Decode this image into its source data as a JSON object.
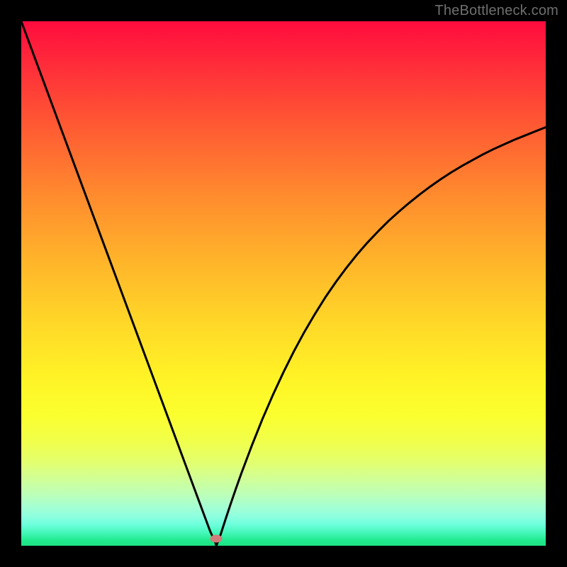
{
  "watermark": "TheBottleneck.com",
  "colors": {
    "frame": "#000000",
    "marker": "#cf7d7a",
    "curve": "#000000"
  },
  "chart_data": {
    "type": "line",
    "title": "",
    "xlabel": "",
    "ylabel": "",
    "xlim": [
      0,
      100
    ],
    "ylim": [
      0,
      100
    ],
    "grid": false,
    "legend": false,
    "annotations": [
      {
        "type": "marker",
        "x": 37.2,
        "y": 1.3,
        "shape": "ellipse",
        "color": "#cf7d7a"
      }
    ],
    "x": [
      0,
      2,
      4,
      6,
      8,
      10,
      12,
      14,
      16,
      18,
      20,
      22,
      24,
      26,
      28,
      30,
      32,
      33,
      34,
      35,
      36,
      37,
      37.2,
      38,
      39,
      40,
      41,
      42,
      44,
      46,
      48,
      50,
      52,
      54,
      56,
      58,
      60,
      62,
      64,
      66,
      68,
      70,
      72,
      74,
      76,
      78,
      80,
      82,
      84,
      86,
      88,
      90,
      92,
      94,
      96,
      98,
      100
    ],
    "y": [
      100,
      94.6,
      89.2,
      83.8,
      78.4,
      73.0,
      67.6,
      62.2,
      56.8,
      51.4,
      46.0,
      40.6,
      35.2,
      29.8,
      24.4,
      19.0,
      13.6,
      10.9,
      8.2,
      5.5,
      2.8,
      0.6,
      0.0,
      2.1,
      5.2,
      8.2,
      11.1,
      13.9,
      19.2,
      24.2,
      28.8,
      33.1,
      37.1,
      40.8,
      44.2,
      47.4,
      50.3,
      53.0,
      55.5,
      57.8,
      59.9,
      61.9,
      63.7,
      65.4,
      67.0,
      68.5,
      69.9,
      71.2,
      72.4,
      73.5,
      74.6,
      75.6,
      76.5,
      77.4,
      78.2,
      79.0,
      79.8
    ]
  }
}
